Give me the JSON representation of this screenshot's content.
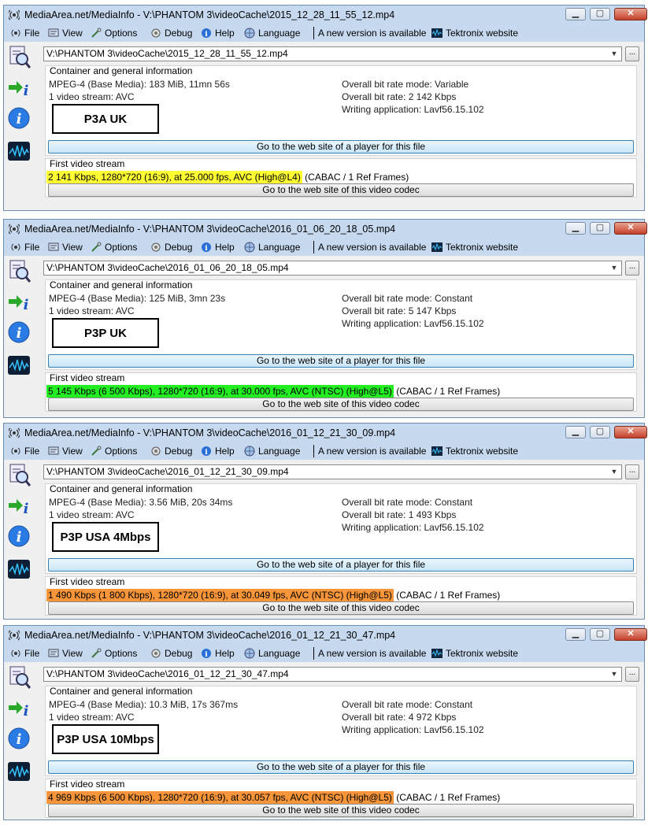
{
  "menu": {
    "file": "File",
    "view": "View",
    "options": "Options",
    "debug": "Debug",
    "help": "Help",
    "language": "Language",
    "new_version": "A new version is available",
    "tektronix": "Tektronix website"
  },
  "buttons": {
    "player": "Go to the web site of a player for this file",
    "codec": "Go to the web site of this video codec",
    "browse": "..."
  },
  "section_titles": {
    "general": "Container and general information",
    "video": "First video stream"
  },
  "windows": [
    {
      "title": "MediaArea.net/MediaInfo - V:\\PHANTOM 3\\videoCache\\2015_12_28_11_55_12.mp4",
      "path": "V:\\PHANTOM 3\\videoCache\\2015_12_28_11_55_12.mp4",
      "format": "MPEG-4 (Base Media): 183 MiB, 11mn 56s",
      "streams": "1 video stream: AVC",
      "bitrate_mode": "Overall bit rate mode: Variable",
      "bitrate": "Overall bit rate: 2 142 Kbps",
      "writing_app": "Writing application: Lavf56.15.102",
      "label": "P3A UK",
      "video_highlight": "2 141 Kbps, 1280*720 (16:9), at 25.000 fps, AVC (High@L4)",
      "video_rest": " (CABAC / 1 Ref Frames)",
      "highlight_color": "#ffff33"
    },
    {
      "title": "MediaArea.net/MediaInfo - V:\\PHANTOM 3\\videoCache\\2016_01_06_20_18_05.mp4",
      "path": "V:\\PHANTOM 3\\videoCache\\2016_01_06_20_18_05.mp4",
      "format": "MPEG-4 (Base Media): 125 MiB, 3mn 23s",
      "streams": "1 video stream: AVC",
      "bitrate_mode": "Overall bit rate mode: Constant",
      "bitrate": "Overall bit rate: 5 147 Kbps",
      "writing_app": "Writing application: Lavf56.15.102",
      "label": "P3P UK",
      "video_highlight": "5 145 Kbps (6 500 Kbps), 1280*720 (16:9), at 30.000 fps, AVC (NTSC) (High@L5)",
      "video_rest": " (CABAC / 1 Ref Frames)",
      "highlight_color": "#22ee22"
    },
    {
      "title": "MediaArea.net/MediaInfo - V:\\PHANTOM 3\\videoCache\\2016_01_12_21_30_09.mp4",
      "path": "V:\\PHANTOM 3\\videoCache\\2016_01_12_21_30_09.mp4",
      "format": "MPEG-4 (Base Media): 3.56 MiB, 20s 34ms",
      "streams": "1 video stream: AVC",
      "bitrate_mode": "Overall bit rate mode: Constant",
      "bitrate": "Overall bit rate: 1 493 Kbps",
      "writing_app": "Writing application: Lavf56.15.102",
      "label": "P3P USA 4Mbps",
      "video_highlight": "1 490 Kbps (1 800 Kbps), 1280*720 (16:9), at 30.049 fps, AVC (NTSC) (High@L5)",
      "video_rest": " (CABAC / 1 Ref Frames)",
      "highlight_color": "#f7953a"
    },
    {
      "title": "MediaArea.net/MediaInfo - V:\\PHANTOM 3\\videoCache\\2016_01_12_21_30_47.mp4",
      "path": "V:\\PHANTOM 3\\videoCache\\2016_01_12_21_30_47.mp4",
      "format": "MPEG-4 (Base Media): 10.3 MiB, 17s 367ms",
      "streams": "1 video stream: AVC",
      "bitrate_mode": "Overall bit rate mode: Constant",
      "bitrate": "Overall bit rate: 4 972 Kbps",
      "writing_app": "Writing application: Lavf56.15.102",
      "label": "P3P USA 10Mbps",
      "video_highlight": "4 969 Kbps (6 500 Kbps), 1280*720 (16:9), at 30.057 fps, AVC (NTSC) (High@L5)",
      "video_rest": " (CABAC / 1 Ref Frames)",
      "highlight_color": "#f7953a"
    }
  ]
}
